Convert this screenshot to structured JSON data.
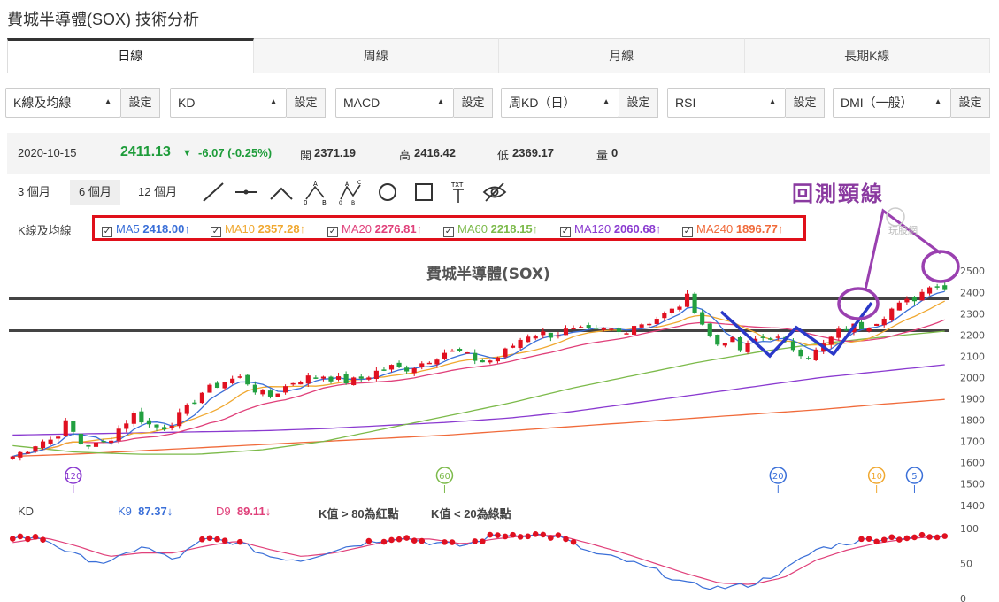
{
  "page": {
    "title": "費城半導體(SOX) 技術分析"
  },
  "tabs": [
    "日線",
    "周線",
    "月線",
    "長期K線"
  ],
  "selectors": [
    {
      "value": "K線及均線",
      "button": "設定"
    },
    {
      "value": "KD",
      "button": "設定"
    },
    {
      "value": "MACD",
      "button": "設定"
    },
    {
      "value": "周KD（日）",
      "button": "設定"
    },
    {
      "value": "RSI",
      "button": "設定"
    },
    {
      "value": "DMI（一般）",
      "button": "設定"
    }
  ],
  "quote": {
    "date": "2020-10-15",
    "price": "2411.13",
    "change": "-6.07 (-0.25%)",
    "open_label": "開",
    "open": "2371.19",
    "high_label": "高",
    "high": "2416.42",
    "low_label": "低",
    "low": "2369.17",
    "vol_label": "量",
    "vol": "0"
  },
  "ranges": [
    "3 個月",
    "6 個月",
    "12 個月"
  ],
  "active_range": "6 個月",
  "tools": [
    "line-tool-icon",
    "segment-tool-icon",
    "angle-tool-icon",
    "abc-pattern-icon",
    "abcd-pattern-icon",
    "circle-tool-icon",
    "rectangle-tool-icon",
    "text-tool-icon",
    "hide-eye-icon"
  ],
  "text_tool_label": "TXT",
  "ma_panel": {
    "label": "K線及均線",
    "items": [
      {
        "name": "MA5",
        "value": "2418.00",
        "arrow": "↑",
        "color": "#3a6fd8"
      },
      {
        "name": "MA10",
        "value": "2357.28",
        "arrow": "↑",
        "color": "#f0a830"
      },
      {
        "name": "MA20",
        "value": "2276.81",
        "arrow": "↑",
        "color": "#e0407a"
      },
      {
        "name": "MA60",
        "value": "2218.15",
        "arrow": "↑",
        "color": "#7cba4a"
      },
      {
        "name": "MA120",
        "value": "2060.68",
        "arrow": "↑",
        "color": "#8a3ad0"
      },
      {
        "name": "MA240",
        "value": "1896.77",
        "arrow": "↑",
        "color": "#f06a3a"
      }
    ]
  },
  "annotations": {
    "chart_label": "費城半導體(SOX)",
    "handwritten": "回測頸線",
    "watermark": "玩股網"
  },
  "kd_panel": {
    "label": "KD",
    "k_name": "K9",
    "k_value": "87.37",
    "k_arrow": "↓",
    "d_name": "D9",
    "d_value": "89.11",
    "d_arrow": "↓",
    "note1": "K值 > 80為紅點",
    "note2": "K值 < 20為綠點",
    "ticks": [
      0,
      50,
      100
    ]
  },
  "ma_markers": [
    "120",
    "60",
    "20",
    "10",
    "5"
  ],
  "colors": {
    "up": "#e01020",
    "down": "#22a040",
    "price_green": "#1e9c3a",
    "highlight_box": "#e0101a",
    "neckline": "#555555",
    "w_pattern": "#2a38c8",
    "circle": "#9a40b0"
  },
  "chart_data": {
    "type": "candlestick",
    "y_ticks": [
      1400,
      1500,
      1600,
      1700,
      1800,
      1900,
      2000,
      2100,
      2200,
      2300,
      2400,
      2500
    ],
    "ylim": [
      1370,
      2530
    ],
    "neckline_upper": 2370,
    "neckline_lower": 2220,
    "close_anchors": [
      1630,
      1660,
      1700,
      1710,
      1790,
      1690,
      1680,
      1700,
      1770,
      1830,
      1780,
      1760,
      1800,
      1860,
      1930,
      1960,
      1990,
      2000,
      1940,
      1910,
      1950,
      1990,
      2000,
      2010,
      1990,
      1980,
      2000,
      2030,
      2050,
      2040,
      2060,
      2090,
      2120,
      2120,
      2090,
      2070,
      2100,
      2150,
      2200,
      2210,
      2200,
      2220,
      2220,
      2210,
      2230,
      2210,
      2250,
      2260,
      2290,
      2320,
      2380,
      2260,
      2150,
      2190,
      2120,
      2180,
      2200,
      2170,
      2130,
      2100,
      2150,
      2210,
      2240,
      2240,
      2270,
      2320,
      2350,
      2380,
      2450,
      2411
    ],
    "ma120_anchors": [
      1730,
      1735,
      1740,
      1745,
      1750,
      1760,
      1775,
      1790,
      1810,
      1840,
      1880,
      1920,
      1960,
      2000,
      2030,
      2060
    ],
    "ma240_anchors": [
      1630,
      1640,
      1655,
      1670,
      1685,
      1700,
      1715,
      1730,
      1750,
      1770,
      1790,
      1810,
      1830,
      1850,
      1875,
      1897
    ],
    "ma60_anchors": [
      1680,
      1650,
      1640,
      1640,
      1660,
      1700,
      1760,
      1820,
      1880,
      1950,
      2010,
      2070,
      2120,
      2160,
      2190,
      2218
    ],
    "ma_marker_x_index": [
      8,
      57,
      101,
      114,
      119
    ],
    "kd_k_anchors": [
      88,
      85,
      60,
      50,
      75,
      55,
      85,
      80,
      60,
      55,
      70,
      80,
      88,
      80,
      75,
      90,
      92,
      88,
      65,
      55,
      40,
      20,
      15,
      20,
      40,
      70,
      80,
      86,
      88,
      87
    ],
    "kd_d_anchors": [
      80,
      87,
      75,
      60,
      65,
      65,
      75,
      82,
      70,
      60,
      65,
      75,
      85,
      85,
      78,
      85,
      90,
      90,
      78,
      65,
      50,
      35,
      22,
      20,
      30,
      55,
      70,
      80,
      86,
      89
    ]
  }
}
